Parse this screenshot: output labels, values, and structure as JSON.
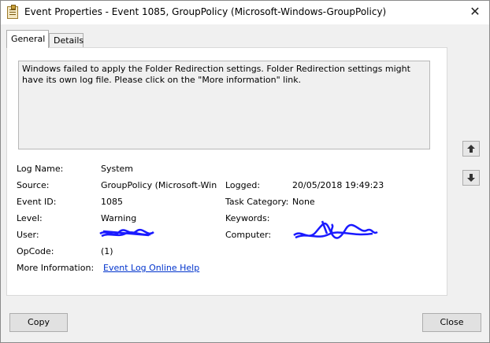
{
  "window": {
    "title": "Event Properties - Event 1085, GroupPolicy (Microsoft-Windows-GroupPolicy)",
    "close_glyph": "✕"
  },
  "tabs": [
    {
      "label": "General",
      "active": true
    },
    {
      "label": "Details",
      "active": false
    }
  ],
  "description": "Windows failed to apply the Folder Redirection settings. Folder Redirection settings might have its own log file. Please click on the \"More information\" link.",
  "fields": {
    "log_name": {
      "label": "Log Name:",
      "value": "System"
    },
    "source": {
      "label": "Source:",
      "value": "GroupPolicy (Microsoft-Win"
    },
    "logged": {
      "label": "Logged:",
      "value": "20/05/2018 19:49:23"
    },
    "event_id": {
      "label": "Event ID:",
      "value": "1085"
    },
    "task_category": {
      "label": "Task Category:",
      "value": "None"
    },
    "level": {
      "label": "Level:",
      "value": "Warning"
    },
    "keywords": {
      "label": "Keywords:",
      "value": ""
    },
    "user": {
      "label": "User:",
      "value": ""
    },
    "computer": {
      "label": "Computer:",
      "value": ""
    },
    "opcode": {
      "label": "OpCode:",
      "value": "(1)"
    },
    "more_info": {
      "label": "More Information:",
      "link": "Event Log Online Help"
    }
  },
  "redaction_color": "#1a1aff",
  "icons": {
    "up": "arrow-up-icon",
    "down": "arrow-down-icon"
  },
  "buttons": {
    "copy": "Copy",
    "close": "Close"
  }
}
